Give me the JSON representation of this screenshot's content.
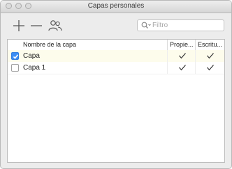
{
  "window": {
    "title": "Capas personales"
  },
  "toolbar": {
    "add_icon": "plus-icon",
    "remove_icon": "minus-icon",
    "users_icon": "users-icon"
  },
  "search": {
    "placeholder": "Filtro",
    "value": "",
    "icon": "search-icon"
  },
  "table": {
    "columns": [
      "Nombre de la capa",
      "Propie...",
      "Escritu..."
    ],
    "rows": [
      {
        "checked": true,
        "name": "Capa",
        "propietario": true,
        "escritura": true
      },
      {
        "checked": false,
        "name": "Capa 1",
        "propietario": true,
        "escritura": true
      }
    ]
  },
  "colors": {
    "accent": "#3b8ff3",
    "selected_row": "#fdfcec"
  }
}
